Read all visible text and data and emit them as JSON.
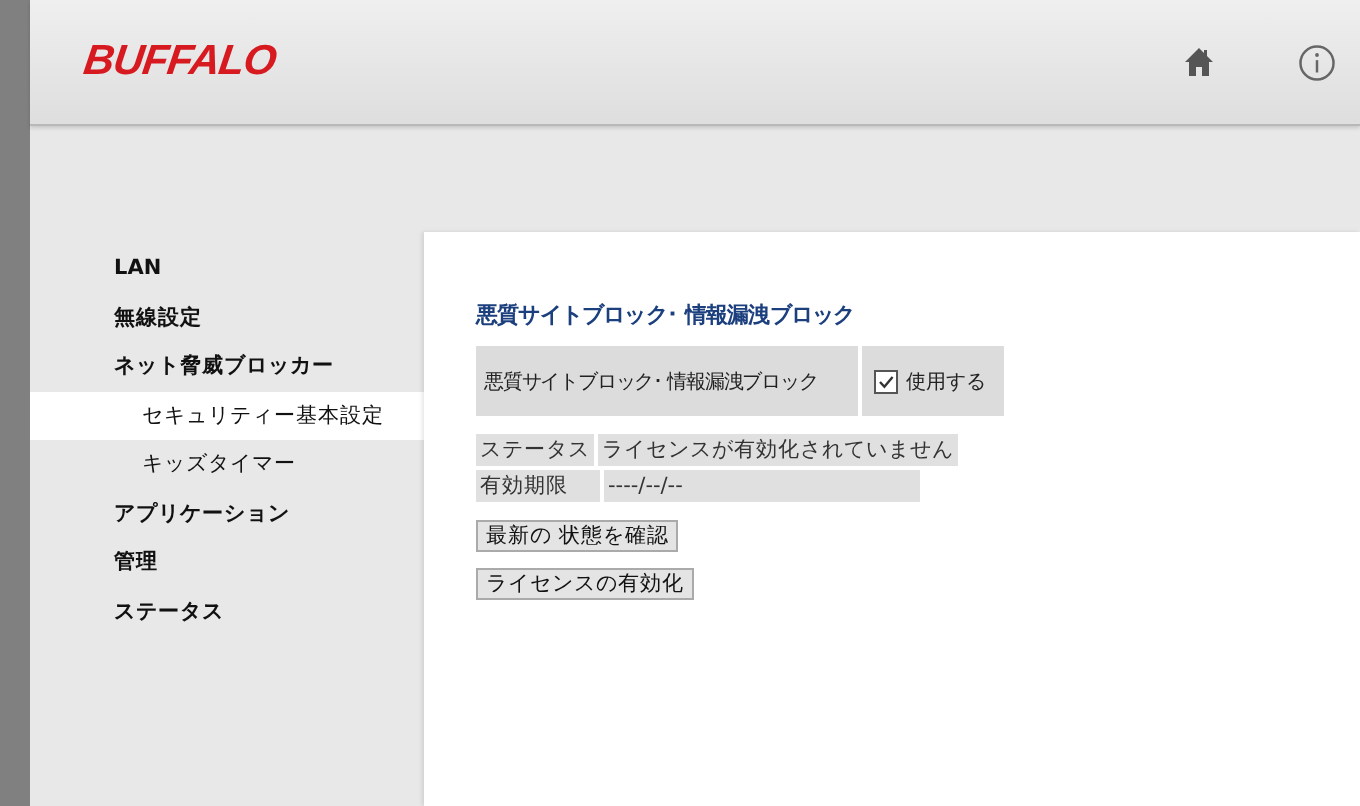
{
  "header": {
    "logo": "BUFFALO"
  },
  "sidebar": {
    "items": [
      {
        "label": "LAN",
        "selected": false
      },
      {
        "label": "無線設定",
        "selected": false
      },
      {
        "label": "ネット脅威ブロッカー",
        "selected": false,
        "children": [
          {
            "label": "セキュリティー基本設定",
            "selected": true
          },
          {
            "label": "キッズタイマー",
            "selected": false
          }
        ]
      },
      {
        "label": "アプリケーション",
        "selected": false
      },
      {
        "label": "管理",
        "selected": false
      },
      {
        "label": "ステータス",
        "selected": false
      }
    ]
  },
  "content": {
    "title": "悪質サイトブロック･ 情報漏洩ブロック",
    "setting": {
      "label": "悪質サイトブロック･ 情報漏洩ブロック",
      "checkbox_label": "使用する",
      "checked": true
    },
    "info_rows": [
      {
        "label": "ステータス",
        "value": "ライセンスが有効化されていません"
      },
      {
        "label": "有効期限",
        "value": "----/--/--"
      }
    ],
    "buttons": [
      "最新の 状態を確認",
      "ライセンスの有効化"
    ]
  }
}
